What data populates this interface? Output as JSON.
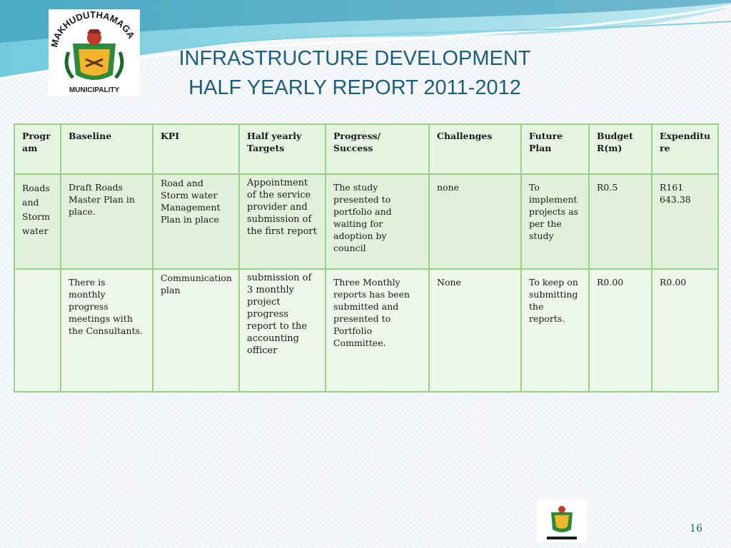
{
  "logo": {
    "name": "MAKHUDUTHAMAGA",
    "sub": "MUNICIPALITY"
  },
  "title": {
    "line1": "INFRASTRUCTURE DEVELOPMENT",
    "line2": "HALF YEARLY REPORT 2011-2012"
  },
  "table": {
    "headers": [
      "Progr am",
      "Baseline",
      "KPI",
      "Half yearly Targets",
      "Progress/ Success",
      "Challenges",
      "Future Plan",
      "Budget R(m)",
      "Expenditu re"
    ],
    "header_lines": [
      [
        "Progr",
        "am"
      ],
      [
        "Baseline"
      ],
      [
        "KPI"
      ],
      [
        "Half yearly",
        "Targets"
      ],
      [
        "Progress/",
        "Success"
      ],
      [
        "Challenges"
      ],
      [
        "Future",
        "Plan"
      ],
      [
        "Budget",
        "R(m)"
      ],
      [
        "Expenditu",
        "re"
      ]
    ],
    "rows": [
      {
        "programme": "Roads and Storm water",
        "baseline": "Draft Roads Master Plan in place.",
        "kpi": "Road and Storm water Management Plan in place",
        "target": "Appointment of the service provider and submission of the first report",
        "progress": "The study presented to portfolio and waiting for adoption by council",
        "challenges": "none",
        "future_plan": "To implement projects as per the study",
        "budget": "R0.5",
        "expenditure": "R161 643.38"
      },
      {
        "programme": "",
        "baseline": "There is monthly progress meetings with the Consultants.",
        "kpi": "Communication plan",
        "target": "submission of 3 monthly project progress report to the accounting officer",
        "progress": "Three Monthly reports has been submitted and presented to Portfolio Committee.",
        "challenges": "None",
        "future_plan": "To keep on submitting the reports.",
        "budget": "R0.00",
        "expenditure": "R0.00"
      }
    ]
  },
  "page_number": "16",
  "colors": {
    "title": "#1d5f7a",
    "grid": "#9ad089",
    "row_shade": "#e2f1dc"
  }
}
